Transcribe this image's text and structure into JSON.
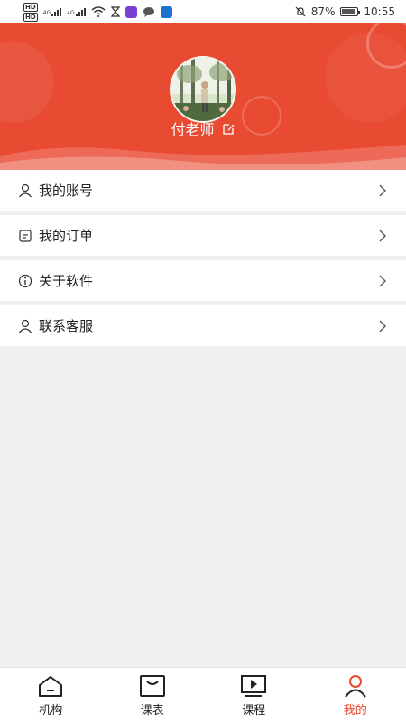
{
  "status_bar": {
    "battery": "87%",
    "time": "10:55",
    "net_1": "HD",
    "net_2": "HD",
    "gen_1": "4G",
    "gen_2": "4G",
    "battery_level": 0.87
  },
  "profile": {
    "name": "付老师",
    "avatar_icon": "avatar-photo",
    "edit_icon": "edit-icon"
  },
  "menu": {
    "items": [
      {
        "label": "我的账号",
        "icon": "user-icon"
      },
      {
        "label": "我的订单",
        "icon": "order-icon"
      },
      {
        "label": "关于软件",
        "icon": "info-icon"
      },
      {
        "label": "联系客服",
        "icon": "user-icon"
      }
    ]
  },
  "nav": {
    "items": [
      {
        "label": "机构",
        "icon": "home-icon",
        "active": false
      },
      {
        "label": "课表",
        "icon": "schedule-icon",
        "active": false
      },
      {
        "label": "课程",
        "icon": "play-icon",
        "active": false
      },
      {
        "label": "我的",
        "icon": "profile-icon",
        "active": true
      }
    ],
    "active_color": "#e84a32"
  },
  "colors": {
    "header_bg": "#e84a32",
    "page_bg": "#f0f0f0"
  }
}
